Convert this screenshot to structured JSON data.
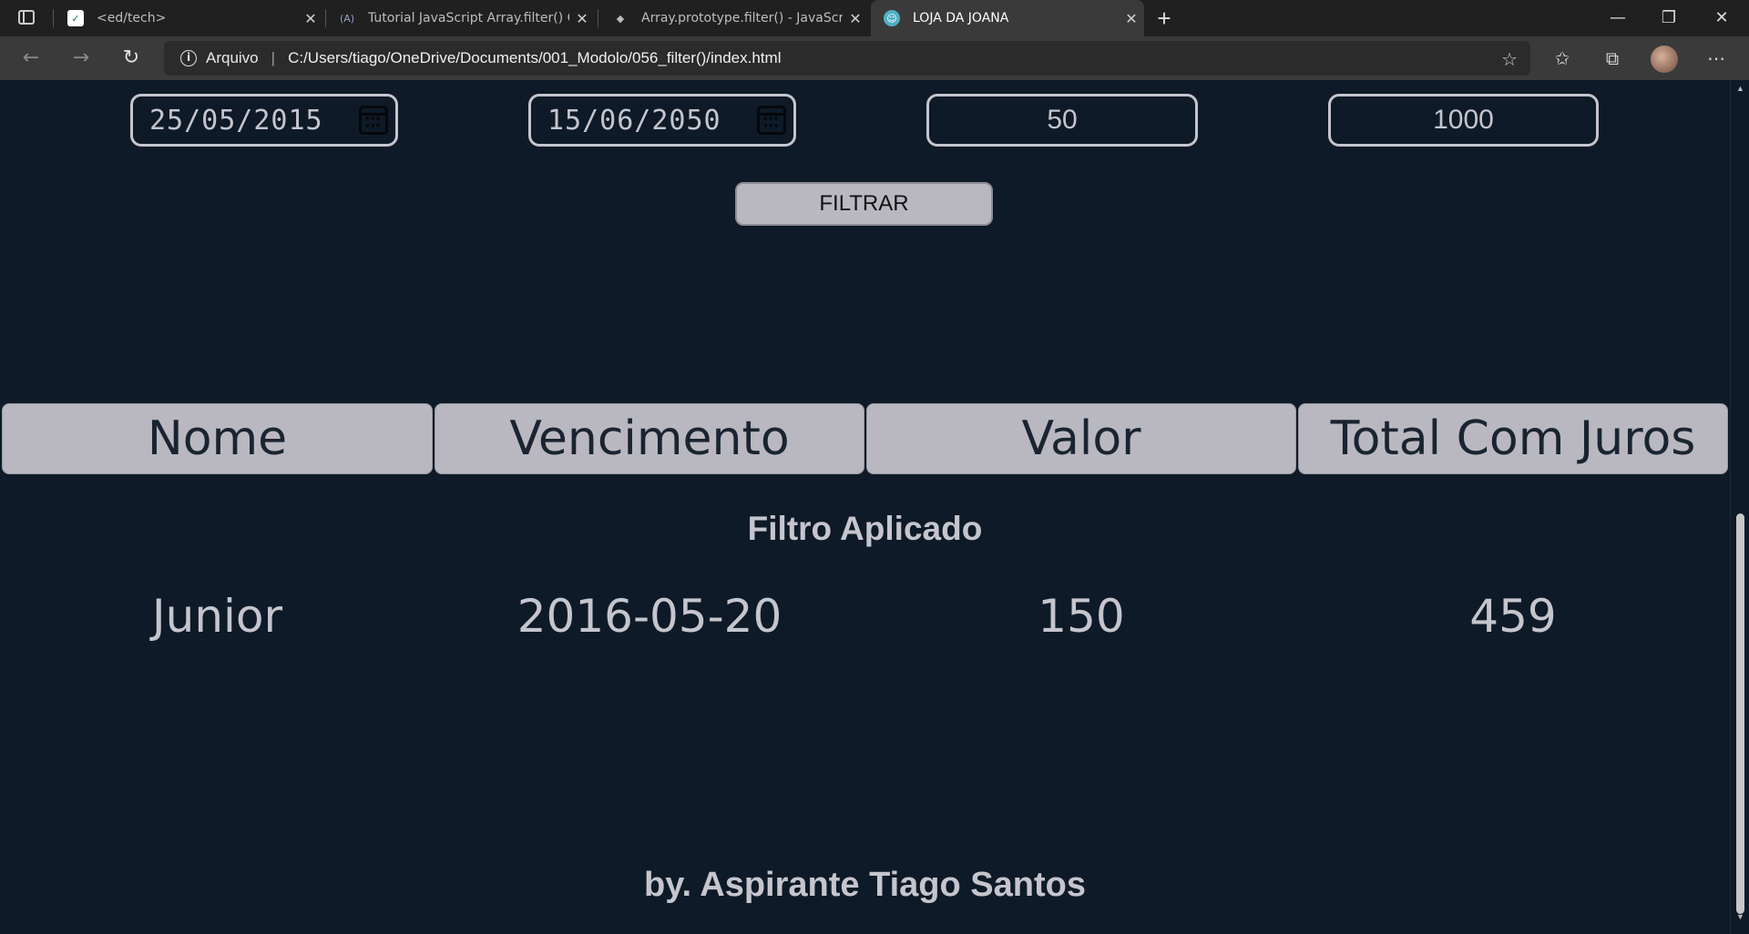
{
  "browser": {
    "tabs": [
      {
        "title": "<ed/tech>",
        "favicon": "edtech-shield-icon",
        "active": false
      },
      {
        "title": "Tutorial JavaScript Array.filter() C",
        "favicon": "code-icon",
        "active": false
      },
      {
        "title": "Array.prototype.filter() - JavaScri",
        "favicon": "mdn-dino-icon",
        "active": false
      },
      {
        "title": "LOJA DA JOANA",
        "favicon": "shop-icon",
        "active": true
      }
    ],
    "address": {
      "scheme_label": "Arquivo",
      "url": "C:/Users/tiago/OneDrive/Documents/001_Modolo/056_filter()/index.html"
    }
  },
  "filters": {
    "date_start": "25/05/2015",
    "date_end": "15/06/2050",
    "min_value": "50",
    "max_value": "1000",
    "button_label": "FILTRAR"
  },
  "table": {
    "headers": [
      "Nome",
      "Vencimento",
      "Valor",
      "Total Com Juros"
    ],
    "status_text": "Filtro Aplicado",
    "rows": [
      [
        "Junior",
        "2016-05-20",
        "150",
        "459"
      ]
    ]
  },
  "footer": {
    "credit": "by. Aspirante Tiago Santos"
  },
  "colors": {
    "page_bg": "#0e1a27",
    "header_cell_bg": "#b9b8c0",
    "text_light": "#c5c5cd"
  }
}
